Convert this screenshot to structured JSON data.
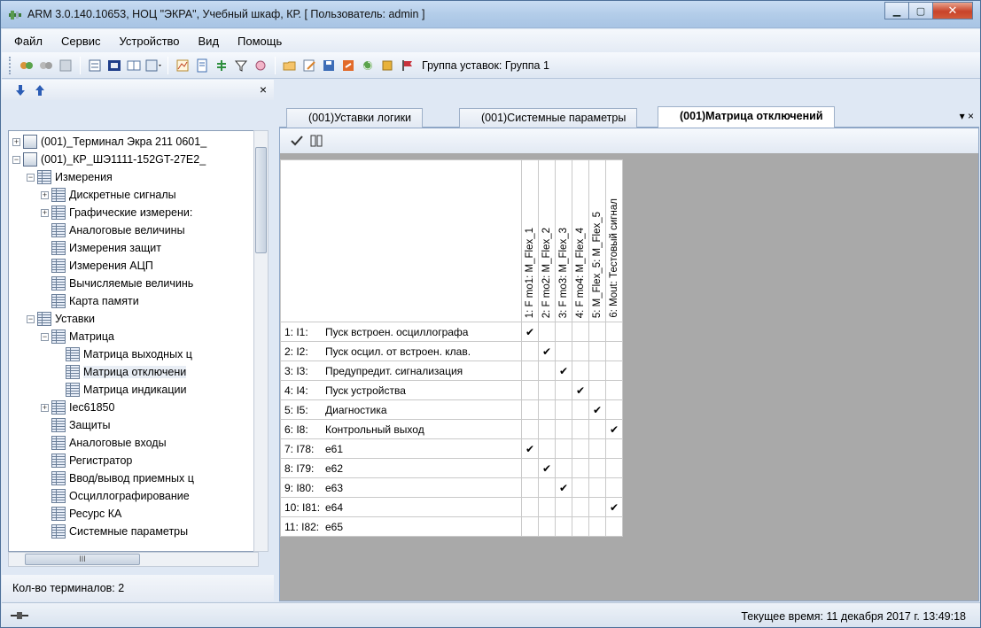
{
  "window": {
    "title": "ARM 3.0.140.10653, НОЦ \"ЭКРА\", Учебный шкаф, КР. [ Пользователь: admin ]",
    "minimize_icon": "minimize-icon",
    "maximize_icon": "maximize-icon",
    "close_icon": "close-icon"
  },
  "menu": [
    "Файл",
    "Сервис",
    "Устройство",
    "Вид",
    "Помощь"
  ],
  "toolbar": {
    "group_label": "Группа уставок: Группа 1"
  },
  "left_panel": {
    "down_arrow": "arrow-down-icon",
    "up_arrow": "arrow-up-icon",
    "close": "×",
    "tree": [
      {
        "label": "(001)_Терминал Экра 211 0601_",
        "level": 0,
        "expander": "+"
      },
      {
        "label": "(001)_КР_ШЭ1111-152GT-27Е2_",
        "level": 0,
        "expander": "−"
      },
      {
        "label": "Измерения",
        "level": 1,
        "expander": "−"
      },
      {
        "label": "Дискретные сигналы",
        "level": 2,
        "expander": "+"
      },
      {
        "label": "Графические измерени:",
        "level": 2,
        "expander": "+"
      },
      {
        "label": "Аналоговые величины",
        "level": 2,
        "expander": ""
      },
      {
        "label": "Измерения защит",
        "level": 2,
        "expander": ""
      },
      {
        "label": "Измерения АЦП",
        "level": 2,
        "expander": ""
      },
      {
        "label": "Вычисляемые величинь",
        "level": 2,
        "expander": ""
      },
      {
        "label": "Карта памяти",
        "level": 2,
        "expander": ""
      },
      {
        "label": "Уставки",
        "level": 1,
        "expander": "−"
      },
      {
        "label": "Матрица",
        "level": 2,
        "expander": "−"
      },
      {
        "label": "Матрица выходных ц",
        "level": 3,
        "expander": ""
      },
      {
        "label": "Матрица отключени",
        "level": 3,
        "expander": ""
      },
      {
        "label": "Матрица индикации",
        "level": 3,
        "expander": ""
      },
      {
        "label": "Iec61850",
        "level": 2,
        "expander": "+"
      },
      {
        "label": "Защиты",
        "level": 2,
        "expander": ""
      },
      {
        "label": "Аналоговые входы",
        "level": 2,
        "expander": ""
      },
      {
        "label": "Регистратор",
        "level": 2,
        "expander": ""
      },
      {
        "label": "Ввод/вывод приемных ц",
        "level": 2,
        "expander": ""
      },
      {
        "label": "Осциллографирование",
        "level": 2,
        "expander": ""
      },
      {
        "label": "Ресурс КА",
        "level": 2,
        "expander": ""
      },
      {
        "label": "Системные параметры",
        "level": 2,
        "expander": ""
      }
    ],
    "scroll_thumb_label": "III",
    "terminal_count": "Кол-во терминалов: 2"
  },
  "tabs": [
    {
      "label": "(001)Уставки логики",
      "active": false
    },
    {
      "label": "(001)Системные параметры",
      "active": false
    },
    {
      "label": "(001)Матрица отключений",
      "active": true
    }
  ],
  "tab_controls": "▾ ×",
  "matrix": {
    "columns": [
      "1: F mo1: M_Flex_1",
      "2: F mo2: M_Flex_2",
      "3: F mo3: M_Flex_3",
      "4: F mo4: M_Flex_4",
      "5: M_Flex_5: M_Flex_5",
      "6: Mout: Тестовый сигнал"
    ],
    "rows": [
      {
        "num": "1: I1:",
        "name": "Пуск встроен. осциллографа",
        "checks": [
          1,
          0,
          0,
          0,
          0,
          0
        ]
      },
      {
        "num": "2: I2:",
        "name": "Пуск осцил. от встроен. клав.",
        "checks": [
          0,
          1,
          0,
          0,
          0,
          0
        ]
      },
      {
        "num": "3: I3:",
        "name": "Предупредит. сигнализация",
        "checks": [
          0,
          0,
          1,
          0,
          0,
          0
        ]
      },
      {
        "num": "4: I4:",
        "name": "Пуск устройства",
        "checks": [
          0,
          0,
          0,
          1,
          0,
          0
        ]
      },
      {
        "num": "5: I5:",
        "name": "Диагностика",
        "checks": [
          0,
          0,
          0,
          0,
          1,
          0
        ]
      },
      {
        "num": "6: I8:",
        "name": "Контрольный выход",
        "checks": [
          0,
          0,
          0,
          0,
          0,
          1
        ]
      },
      {
        "num": "7: I78:",
        "name": "e61",
        "checks": [
          1,
          0,
          0,
          0,
          0,
          0
        ]
      },
      {
        "num": "8: I79:",
        "name": "e62",
        "checks": [
          0,
          1,
          0,
          0,
          0,
          0
        ]
      },
      {
        "num": "9: I80:",
        "name": "e63",
        "checks": [
          0,
          0,
          1,
          0,
          0,
          0
        ]
      },
      {
        "num": "10: I81:",
        "name": "e64",
        "checks": [
          0,
          0,
          0,
          0,
          0,
          1
        ]
      },
      {
        "num": "11: I82:",
        "name": "e65",
        "checks": [
          0,
          0,
          0,
          0,
          0,
          0
        ]
      }
    ],
    "check_glyph": "✔"
  },
  "status": {
    "time": "Текущее время: 11 декабря 2017 г. 13:49:18"
  }
}
